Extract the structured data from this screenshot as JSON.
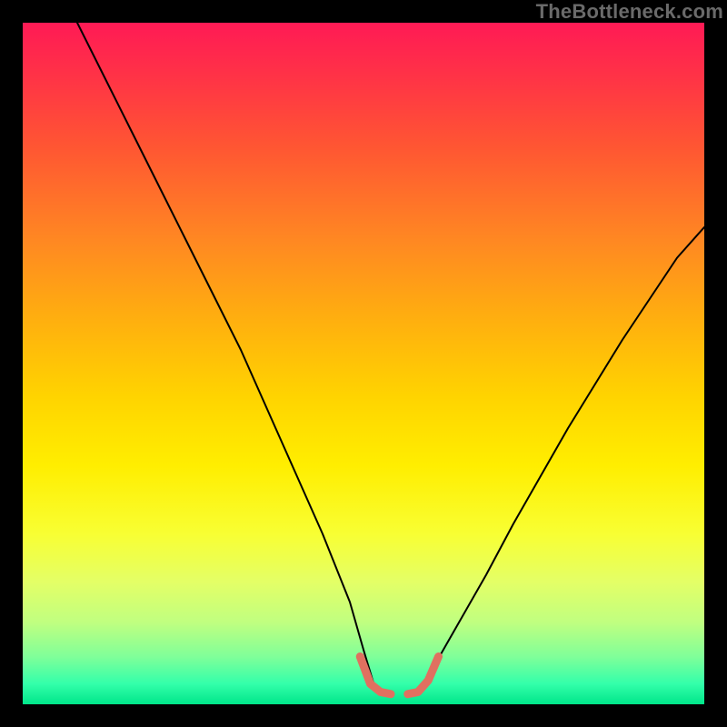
{
  "watermark": "TheBottleneck.com",
  "chart_data": {
    "type": "line",
    "title": "",
    "xlabel": "",
    "ylabel": "",
    "xlim": [
      0,
      100
    ],
    "ylim": [
      0,
      100
    ],
    "grid": false,
    "legend": false,
    "notes": "Bottleneck-style V-curve over red→yellow→green vertical gradient. No axis ticks or numeric labels are visible, so x/y values are estimated from pixel positions as percentages of the plot area. Two thin black branches descend to a narrow valley near x≈55; short thick salmon segments overlay the valley endpoints.",
    "series": [
      {
        "name": "left-branch-black",
        "stroke": "#000000",
        "stroke_width": 2,
        "x": [
          8.0,
          12.0,
          16.0,
          20.0,
          24.0,
          28.0,
          32.0,
          36.0,
          40.0,
          44.0,
          48.0,
          50.0,
          51.5
        ],
        "y": [
          100.0,
          92.0,
          84.0,
          76.0,
          68.0,
          60.0,
          52.0,
          43.0,
          34.0,
          25.0,
          15.0,
          8.0,
          3.0
        ]
      },
      {
        "name": "right-branch-black",
        "stroke": "#000000",
        "stroke_width": 2,
        "x": [
          58.5,
          60.0,
          64.0,
          68.0,
          72.0,
          76.0,
          80.0,
          84.0,
          88.0,
          92.0,
          96.0,
          100.0
        ],
        "y": [
          2.5,
          5.0,
          12.0,
          19.0,
          26.5,
          33.5,
          40.5,
          47.0,
          53.5,
          59.5,
          65.5,
          70.0
        ]
      },
      {
        "name": "valley-left-salmon",
        "stroke": "#e07060",
        "stroke_width": 9,
        "x": [
          49.5,
          51.0,
          52.5,
          54.0
        ],
        "y": [
          7.0,
          3.0,
          1.8,
          1.5
        ]
      },
      {
        "name": "valley-right-salmon",
        "stroke": "#e07060",
        "stroke_width": 9,
        "x": [
          56.5,
          58.0,
          59.5,
          61.0
        ],
        "y": [
          1.5,
          1.8,
          3.5,
          7.0
        ]
      }
    ]
  }
}
